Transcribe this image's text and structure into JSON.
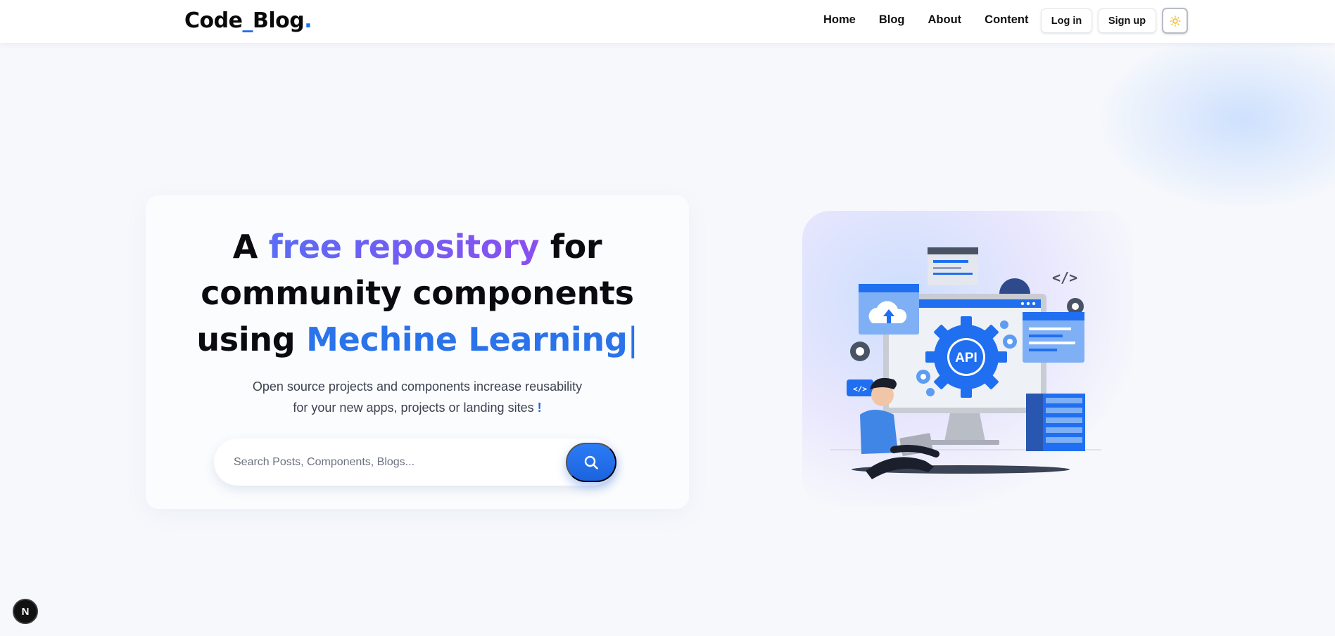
{
  "brand": {
    "name": "Code",
    "sep": "_",
    "name2": "Blog",
    "dot": "."
  },
  "nav": {
    "links": [
      "Home",
      "Blog",
      "About",
      "Content"
    ],
    "login": "Log in",
    "signup": "Sign up",
    "theme_icon": "sun-icon"
  },
  "hero": {
    "line1_a": "A ",
    "line1_b": "free repository",
    "line1_c": " for",
    "line2": "community components",
    "line3_a": "using ",
    "line3_b": "Mechine Learning",
    "cursor": "|",
    "sub_line1": "Open source projects and components increase reusability",
    "sub_line2": "for your new apps, projects or landing sites ",
    "sub_bang": "!"
  },
  "search": {
    "placeholder": "Search Posts, Components, Blogs...",
    "icon": "search-icon"
  },
  "illustration": {
    "api_label": "API",
    "code_tag": "</>"
  },
  "dev_badge": "N",
  "colors": {
    "accent": "#1f6ff0",
    "gradient_start": "#5b6cf4",
    "gradient_end": "#8a4ff0"
  }
}
